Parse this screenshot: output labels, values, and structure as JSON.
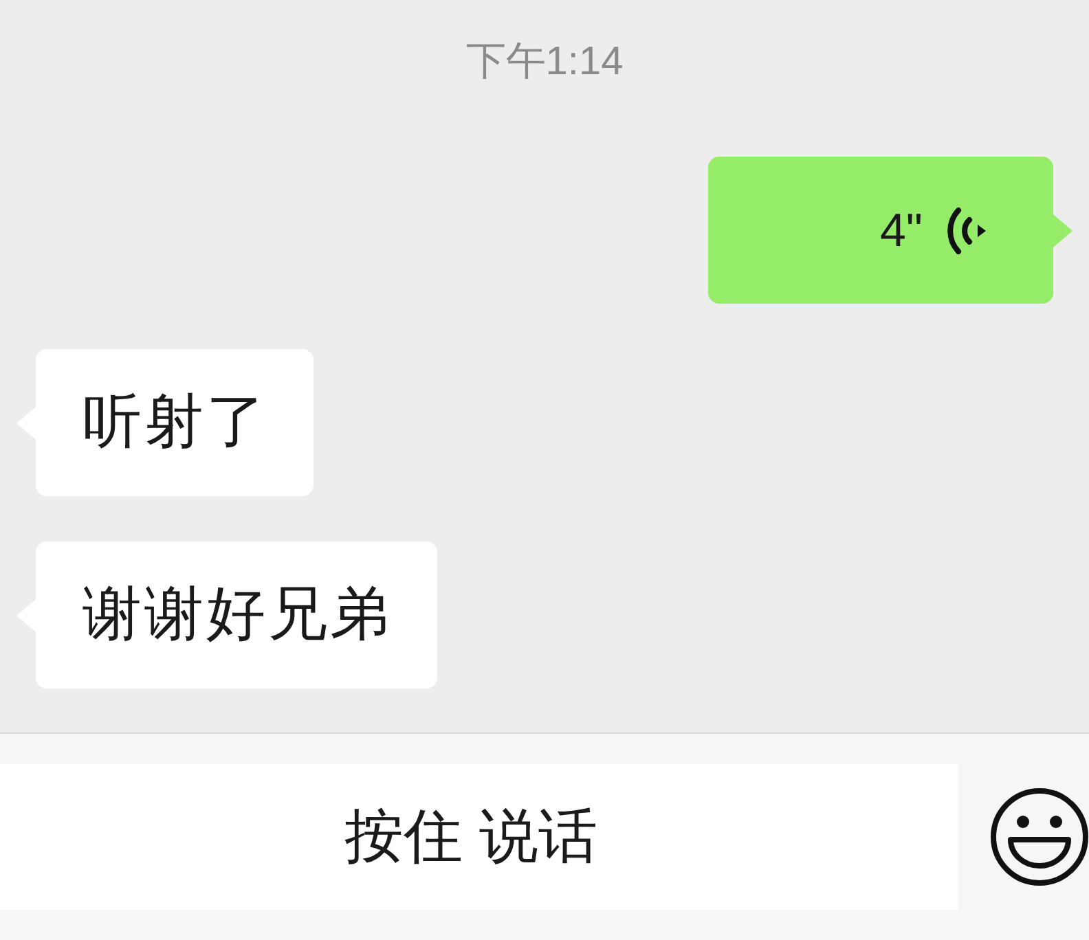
{
  "timestamp": "下午1:14",
  "messages": [
    {
      "kind": "voice",
      "outgoing": true,
      "duration": "4\""
    },
    {
      "kind": "text",
      "outgoing": false,
      "text": "听射了"
    },
    {
      "kind": "text",
      "outgoing": false,
      "text": "谢谢好兄弟"
    }
  ],
  "input_bar": {
    "hold_to_talk": "按住 说话"
  }
}
